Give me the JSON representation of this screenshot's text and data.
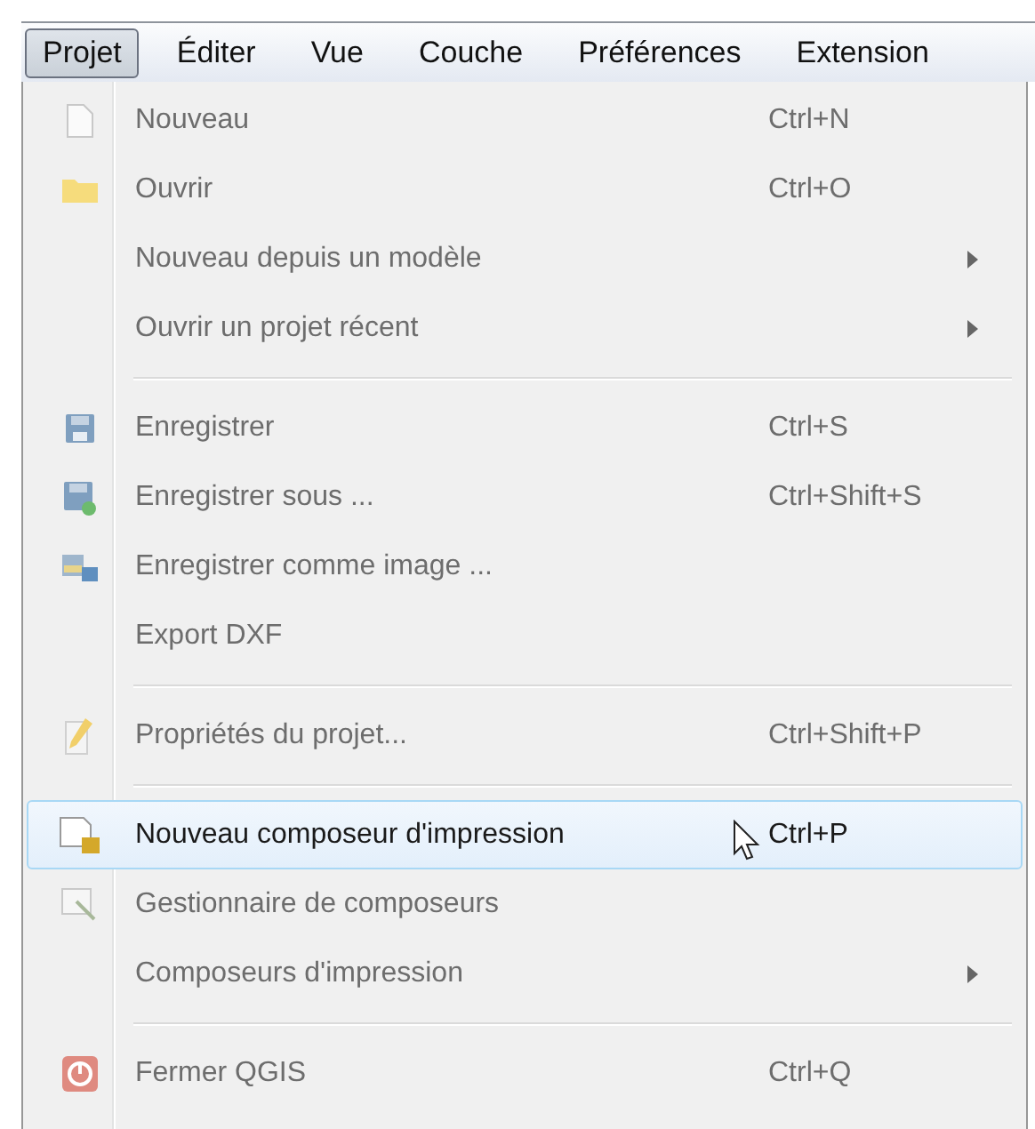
{
  "menubar": [
    {
      "label": "Projet",
      "selected": true
    },
    {
      "label": "Éditer",
      "selected": false
    },
    {
      "label": "Vue",
      "selected": false
    },
    {
      "label": "Couche",
      "selected": false
    },
    {
      "label": "Préférences",
      "selected": false
    },
    {
      "label": "Extension",
      "selected": false
    }
  ],
  "menu": [
    {
      "kind": "item",
      "label": "Nouveau",
      "shortcut": "Ctrl+N",
      "submenu": false,
      "selected": false
    },
    {
      "kind": "item",
      "label": "Ouvrir",
      "shortcut": "Ctrl+O",
      "submenu": false,
      "selected": false
    },
    {
      "kind": "item",
      "label": "Nouveau depuis un modèle",
      "submenu": true,
      "selected": false
    },
    {
      "kind": "item",
      "label": "Ouvrir un projet récent",
      "submenu": true,
      "selected": false
    },
    {
      "kind": "separator"
    },
    {
      "kind": "item",
      "label": "Enregistrer",
      "shortcut": "Ctrl+S",
      "submenu": false,
      "selected": false
    },
    {
      "kind": "item",
      "label": "Enregistrer sous ...",
      "shortcut": "Ctrl+Shift+S",
      "submenu": false,
      "selected": false
    },
    {
      "kind": "item",
      "label": "Enregistrer comme image ...",
      "submenu": false,
      "selected": false
    },
    {
      "kind": "item",
      "label": "Export DXF",
      "submenu": false,
      "selected": false
    },
    {
      "kind": "separator"
    },
    {
      "kind": "item",
      "label": "Propriétés du projet...",
      "shortcut": "Ctrl+Shift+P",
      "submenu": false,
      "selected": false
    },
    {
      "kind": "separator"
    },
    {
      "kind": "item",
      "label": "Nouveau composeur d'impression",
      "shortcut": "Ctrl+P",
      "submenu": false,
      "selected": true
    },
    {
      "kind": "item",
      "label": "Gestionnaire de composeurs",
      "submenu": false,
      "selected": false
    },
    {
      "kind": "item",
      "label": "Composeurs d'impression",
      "submenu": true,
      "selected": false
    },
    {
      "kind": "separator"
    },
    {
      "kind": "item",
      "label": "Fermer QGIS",
      "shortcut": "Ctrl+Q",
      "submenu": false,
      "selected": false
    }
  ]
}
